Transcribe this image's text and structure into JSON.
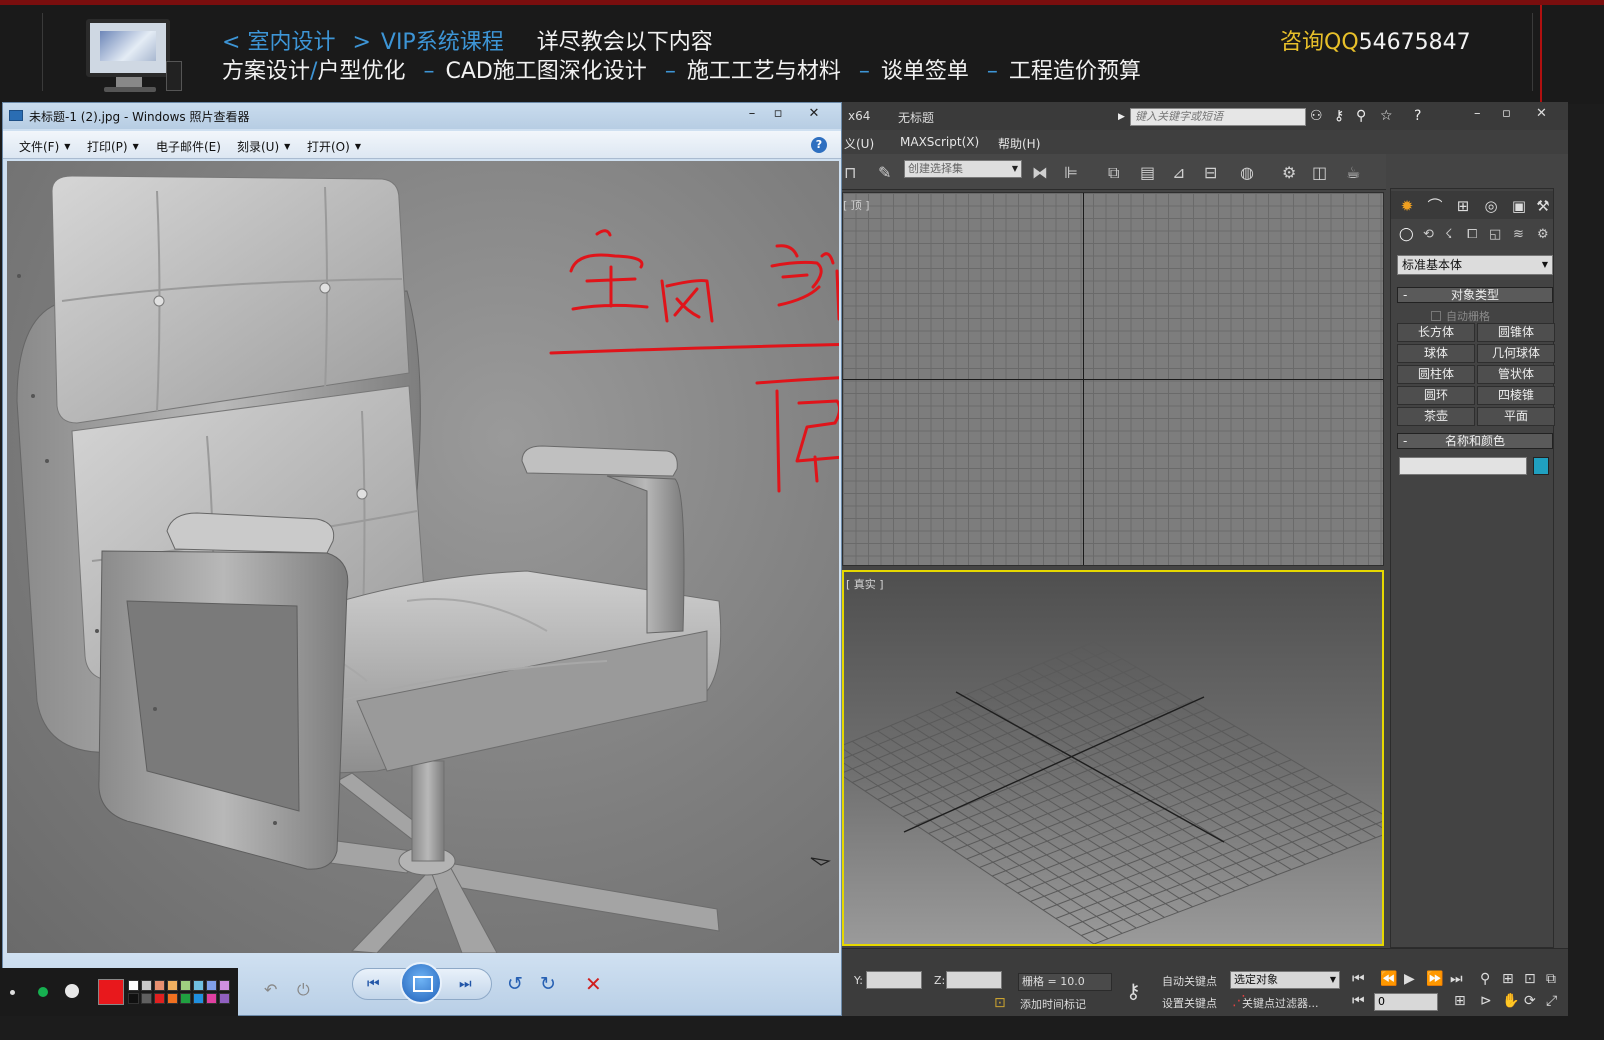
{
  "banner": {
    "breadcrumb_1": "室内设计",
    "breadcrumb_2": "VIP系统课程",
    "tagline": "详尽教会以下内容",
    "course_1": "方案设计",
    "course_1b": "户型优化",
    "course_2": "CAD施工图深化设计",
    "course_3": "施工工艺与材料",
    "course_4": "谈单签单",
    "course_5": "工程造价预算",
    "qq_label": "咨询QQ",
    "qq_number": "54675847"
  },
  "viewer": {
    "title": "未标题-1 (2).jpg - Windows 照片查看器",
    "menu": {
      "file": "文件(F)",
      "print": "打印(P)",
      "email": "电子邮件(E)",
      "burn": "刻录(U)",
      "open": "打开(O)"
    },
    "help": "?",
    "image_icon": "armchair-render-image",
    "handwriting": "red-handwritten-annotation"
  },
  "palette": {
    "current_color": "#e8181c",
    "swatches": [
      "#ffffff",
      "#c8c8c8",
      "#e89070",
      "#f0b060",
      "#a0d080",
      "#70c0e0",
      "#80a0e8",
      "#d090e0",
      "#101010",
      "#606060",
      "#e02020",
      "#f07020",
      "#20a040",
      "#2090e0",
      "#e040a0",
      "#9060c0"
    ]
  },
  "max": {
    "title_build": "x64",
    "title_doc": "无标题",
    "search_placeholder": "键入关键字或短语",
    "menu": {
      "customize": "义(U)",
      "maxscript": "MAXScript(X)",
      "help": "帮助(H)"
    },
    "selection_set": "创建选择集",
    "viewport_top_label": "[ 顶 ]",
    "viewport_persp_label": "[ 真实 ]",
    "command_panel": {
      "dropdown": "标准基本体",
      "rollout_object_type": "对象类型",
      "autogrid": "自动栅格",
      "buttons": [
        "长方体",
        "圆锥体",
        "球体",
        "几何球体",
        "圆柱体",
        "管状体",
        "圆环",
        "四棱锥",
        "茶壶",
        "平面"
      ],
      "rollout_name_color": "名称和颜色",
      "object_color": "#20a0c0"
    },
    "status": {
      "y_label": "Y:",
      "z_label": "Z:",
      "grid": "栅格 = 10.0",
      "auto_key": "自动关键点",
      "selected_object": "选定对象",
      "set_key": "设置关键点",
      "key_filters": "关键点过滤器...",
      "add_time_tag": "添加时间标记",
      "frame": "0"
    }
  }
}
